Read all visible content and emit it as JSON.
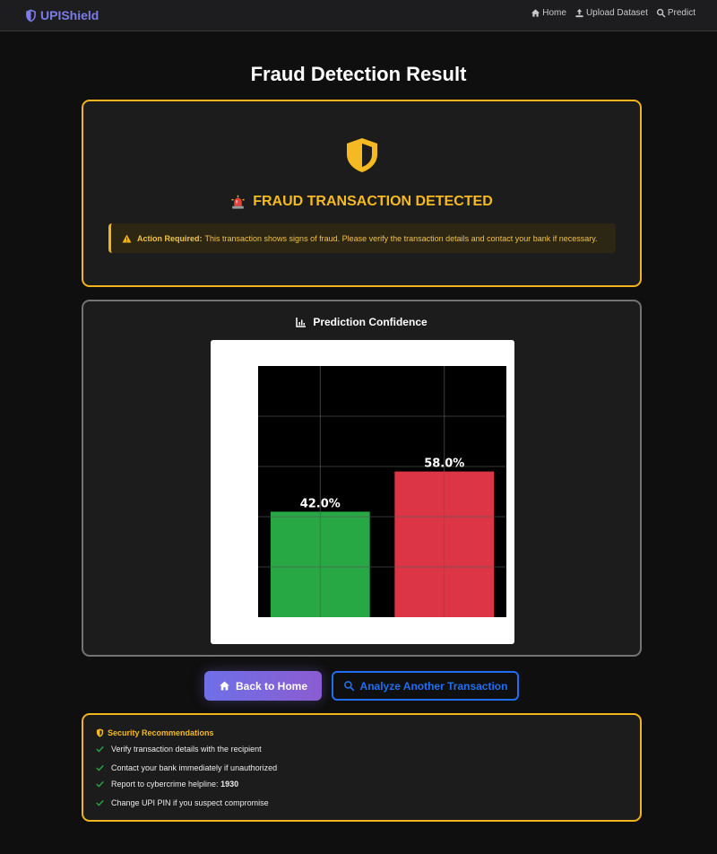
{
  "navbar": {
    "brand": "UPIShield",
    "links": [
      {
        "label": "Home",
        "icon": "home-icon"
      },
      {
        "label": "Upload Dataset",
        "icon": "upload-icon"
      },
      {
        "label": "Predict",
        "icon": "search-icon"
      }
    ]
  },
  "page_title": "Fraud Detection Result",
  "result": {
    "icon": "shield-halved-icon",
    "heading_icon": "siren-icon",
    "heading": "FRAUD TRANSACTION DETECTED",
    "alert_label": "Action Required:",
    "alert_text": "This transaction shows signs of fraud. Please verify the transaction details and contact your bank if necessary."
  },
  "confidence": {
    "title": "Prediction Confidence",
    "icon": "bar-chart-icon"
  },
  "chart_data": {
    "type": "bar",
    "categories": [
      "",
      ""
    ],
    "values": [
      42.0,
      58.0
    ],
    "value_labels": [
      "42.0%",
      "58.0%"
    ],
    "colors": [
      "#28a745",
      "#dc3545"
    ],
    "ylim": [
      0,
      100
    ],
    "grid": true
  },
  "buttons": {
    "home": "Back to Home",
    "analyze": "Analyze Another Transaction"
  },
  "recommendations": {
    "title": "Security Recommendations",
    "items": [
      {
        "text": "Verify transaction details with the recipient",
        "bold": ""
      },
      {
        "text": "Contact your bank immediately if unauthorized",
        "bold": ""
      },
      {
        "text": "Report to cybercrime helpline: ",
        "bold": "1930"
      },
      {
        "text": "Change UPI PIN if you suspect compromise",
        "bold": ""
      }
    ]
  },
  "colors": {
    "accent_warning": "#f0b31c",
    "brand": "#7c7ce8",
    "primary_blue": "#1f6ff0",
    "success": "#28a745",
    "danger": "#dc3545"
  }
}
